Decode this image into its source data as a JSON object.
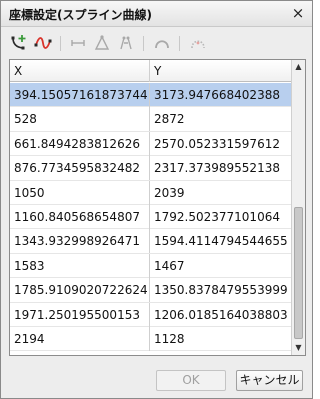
{
  "window": {
    "title": "座標設定(スプライン曲線)",
    "close_glyph": "×"
  },
  "toolbar": {
    "tools": [
      {
        "name": "add-point-tool",
        "icon": "add-point-icon",
        "enabled": true
      },
      {
        "name": "spline-tool",
        "icon": "spline-curve-icon",
        "enabled": true
      },
      {
        "name": "horizontal-align-tool",
        "icon": "horizontal-segment-icon",
        "enabled": false
      },
      {
        "name": "triangle-tool",
        "icon": "triangle-icon",
        "enabled": false
      },
      {
        "name": "mirror-tool",
        "icon": "mirror-icon",
        "enabled": false
      },
      {
        "name": "arc-tool",
        "icon": "arc-icon",
        "enabled": false
      },
      {
        "name": "dotted-arc-tool",
        "icon": "dotted-arc-icon",
        "enabled": false
      }
    ]
  },
  "table": {
    "columns": [
      "X",
      "Y"
    ],
    "rows": [
      {
        "x": "394.15057161873744",
        "y": "3173.947668402388"
      },
      {
        "x": "528",
        "y": "2872"
      },
      {
        "x": "661.8494283812626",
        "y": "2570.052331597612"
      },
      {
        "x": "876.7734595832482",
        "y": "2317.373989552138"
      },
      {
        "x": "1050",
        "y": "2039"
      },
      {
        "x": "1160.840568654807",
        "y": "1792.502377101064"
      },
      {
        "x": "1343.932998926471",
        "y": "1594.4114794544655"
      },
      {
        "x": "1583",
        "y": "1467"
      },
      {
        "x": "1785.9109020722624",
        "y": "1350.8378479553999"
      },
      {
        "x": "1971.250195500153",
        "y": "1206.0185164038803"
      },
      {
        "x": "2194",
        "y": "1128"
      }
    ],
    "selected_row": 0
  },
  "buttons": {
    "ok_label": "OK",
    "cancel_label": "キャンセル"
  },
  "colors": {
    "selection": "#b8cfee",
    "accent_red": "#d9332b",
    "accent_green": "#3a9a3a"
  }
}
